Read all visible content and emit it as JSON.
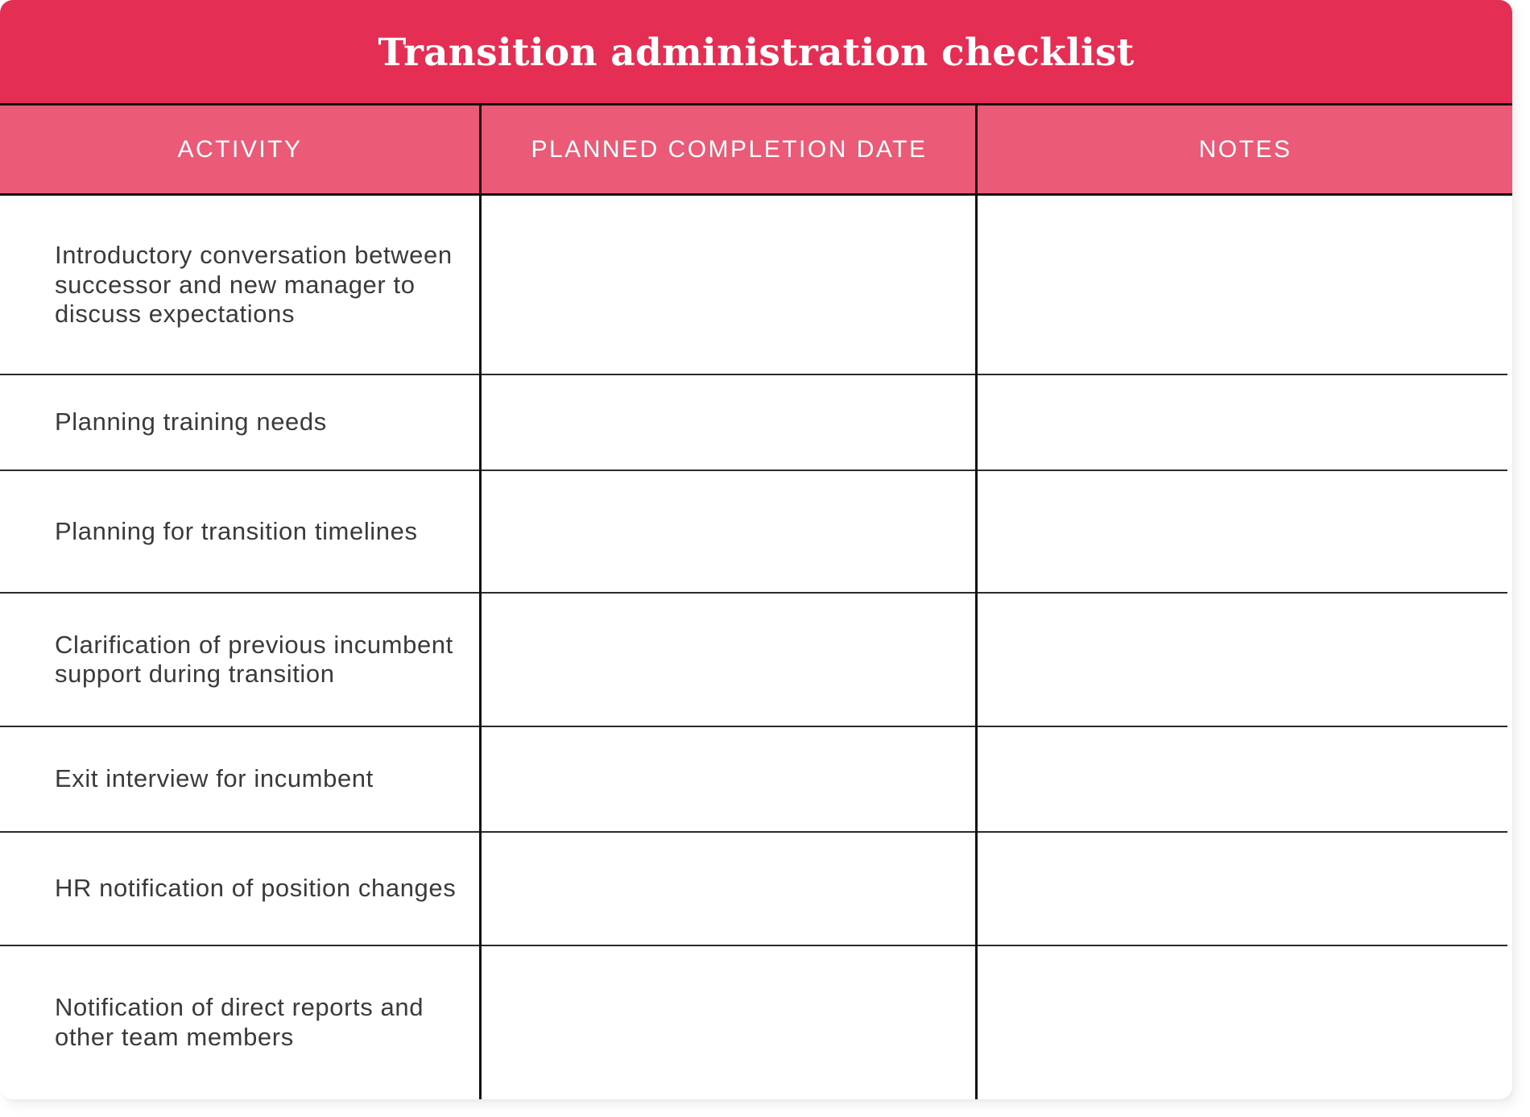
{
  "title": "Transition administration checklist",
  "colors": {
    "title_band": "#e52e53",
    "header_band": "#eb5b77",
    "rule": "#111111",
    "body_text": "#3a3a3a"
  },
  "columns": [
    "ACTIVITY",
    "PLANNED COMPLETION DATE",
    "NOTES"
  ],
  "rows": [
    {
      "activity": "Introductory conversation between successor and new manager to discuss expectations",
      "planned_completion_date": "",
      "notes": ""
    },
    {
      "activity": "Planning training needs",
      "planned_completion_date": "",
      "notes": ""
    },
    {
      "activity": "Planning for transition timelines",
      "planned_completion_date": "",
      "notes": ""
    },
    {
      "activity": "Clarification of previous incumbent support during transition",
      "planned_completion_date": "",
      "notes": ""
    },
    {
      "activity": "Exit interview for incumbent",
      "planned_completion_date": "",
      "notes": ""
    },
    {
      "activity": "HR notification of position changes",
      "planned_completion_date": "",
      "notes": ""
    },
    {
      "activity": "Notification of direct reports and other team members",
      "planned_completion_date": "",
      "notes": ""
    }
  ]
}
